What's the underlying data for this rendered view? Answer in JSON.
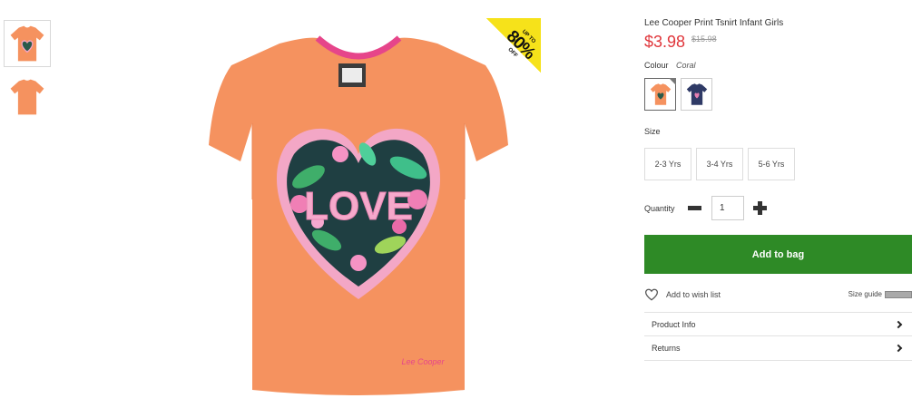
{
  "product": {
    "title": "Lee Cooper Print Tsnirt Infant Girls",
    "price": "$3.98",
    "old_price": "$15.98",
    "brand_label": "Lee Cooper",
    "graphic_text": "LOVE",
    "promo": {
      "line1": "UP TO",
      "big": "80%",
      "line2": "OFF"
    }
  },
  "colour": {
    "label": "Colour",
    "value": "Coral"
  },
  "swatches": [
    {
      "name": "Coral",
      "color": "#f5925f"
    },
    {
      "name": "Navy",
      "color": "#2f3a66"
    }
  ],
  "size": {
    "label": "Size",
    "options": [
      "2-3 Yrs",
      "3-4 Yrs",
      "5-6 Yrs"
    ]
  },
  "quantity": {
    "label": "Quantity",
    "value": "1"
  },
  "actions": {
    "add_to_bag": "Add to bag",
    "wish_list": "Add to wish list",
    "size_guide": "Size guide"
  },
  "accordion": [
    "Product Info",
    "Returns"
  ],
  "colors": {
    "accent_green": "#2e8a26",
    "price_red": "#e0363b",
    "tshirt": "#f5925f",
    "promo_yellow": "#f6e21a"
  }
}
